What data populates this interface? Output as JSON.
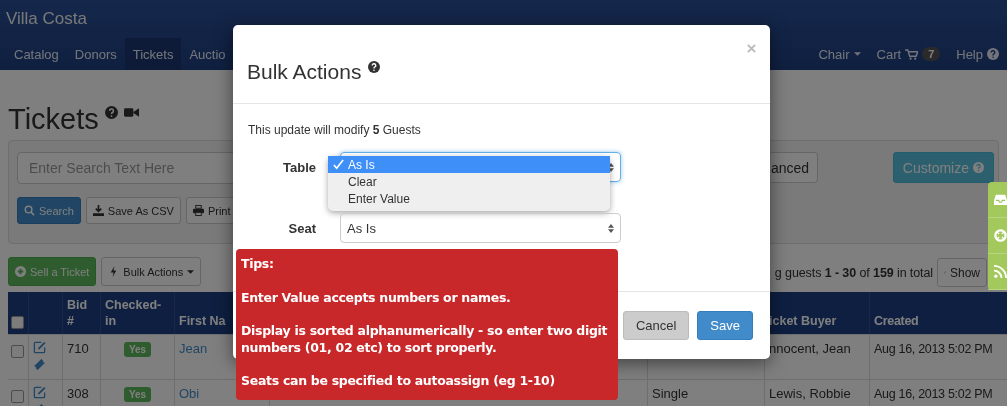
{
  "brand": "Villa Costa",
  "nav_left": [
    {
      "label": "Catalog",
      "selected": false
    },
    {
      "label": "Donors",
      "selected": false
    },
    {
      "label": "Tickets",
      "selected": true
    },
    {
      "label": "Auctio",
      "selected": false
    }
  ],
  "nav_right": [
    {
      "label": "Chair",
      "kind": "dropdown"
    },
    {
      "label": "Cart",
      "kind": "cart",
      "badge": "7"
    },
    {
      "label": "Help",
      "kind": "help"
    }
  ],
  "page": {
    "title": "Tickets"
  },
  "search": {
    "placeholder": "Enter Search Text Here",
    "advanced": "anced",
    "customize": "Customize",
    "buttons": [
      {
        "label": "Search",
        "kind": "search"
      },
      {
        "label": "Save As CSV",
        "kind": "download"
      },
      {
        "label": "Print",
        "kind": "print"
      }
    ]
  },
  "actions": [
    {
      "label": "Sell a Ticket",
      "kind": "add"
    },
    {
      "label": "Bulk Actions",
      "kind": "dropdown"
    }
  ],
  "summary": "g guests **1 - 30** of **159** in total",
  "show_button": "Show",
  "table": {
    "header_checked": false,
    "columns_left": [
      "Bid #",
      "Checked-in",
      "First Na"
    ],
    "columns_right": [
      "icket Buyer",
      "Created"
    ],
    "rows": [
      {
        "checked": false,
        "bid": "710",
        "checked_in": "Yes",
        "first_name": "Jean",
        "buyer": "nnocent, Jean",
        "created": "Aug 16, 2013 5:02 PM"
      },
      {
        "checked": false,
        "bid": "308",
        "checked_in": "Yes",
        "first_name": "Obi",
        "type": "Single",
        "buyer": "Lewis, Robbie",
        "created": "Aug 16, 2013 5:02 PM"
      }
    ]
  },
  "modal": {
    "title": "Bulk Actions",
    "message": "This update will modify **5** Guests",
    "fields": [
      {
        "label": "Table",
        "open": true,
        "options": [
          {
            "label": "As Is",
            "selected": true
          },
          {
            "label": "Clear",
            "selected": false
          },
          {
            "label": "Enter Value",
            "selected": false
          }
        ]
      },
      {
        "label": "Seat",
        "value": "As Is",
        "open": false
      }
    ],
    "buttons": [
      {
        "label": "Cancel",
        "kind": "default"
      },
      {
        "label": "Save",
        "kind": "primary"
      }
    ]
  },
  "tips": {
    "title": "Tips:",
    "lines": [
      "Enter Value accepts numbers or names.",
      "Display is sorted alphanumerically - so enter two digit numbers (01, 02 etc) to sort properly.",
      "Seats can be specified to autoassign (eg 1-10)"
    ]
  }
}
